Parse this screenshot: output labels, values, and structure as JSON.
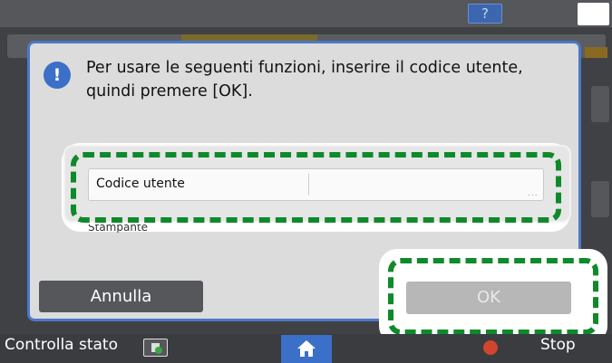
{
  "topbar": {
    "help_label": "?",
    "help_icon": "question-icon",
    "sleep_icon": "moon-icon"
  },
  "dialog": {
    "message": "Per usare le seguenti funzioni, inserire il codice utente, quindi premere [OK].",
    "icon": "info-exclamation-icon",
    "field": {
      "label": "Codice utente",
      "value": "",
      "more_indicator": "..."
    },
    "function_label": "Stampante",
    "cancel_label": "Annulla",
    "ok_label": "OK",
    "ok_enabled": false
  },
  "bottombar": {
    "status_label": "Controlla stato",
    "status_icon": "device-status-icon",
    "home_icon": "home-icon",
    "stop_icon": "stop-icon",
    "stop_label": "Stop"
  },
  "colors": {
    "accent": "#3c6fc7",
    "highlight": "#0f8a2b",
    "stop": "#d2452d"
  }
}
